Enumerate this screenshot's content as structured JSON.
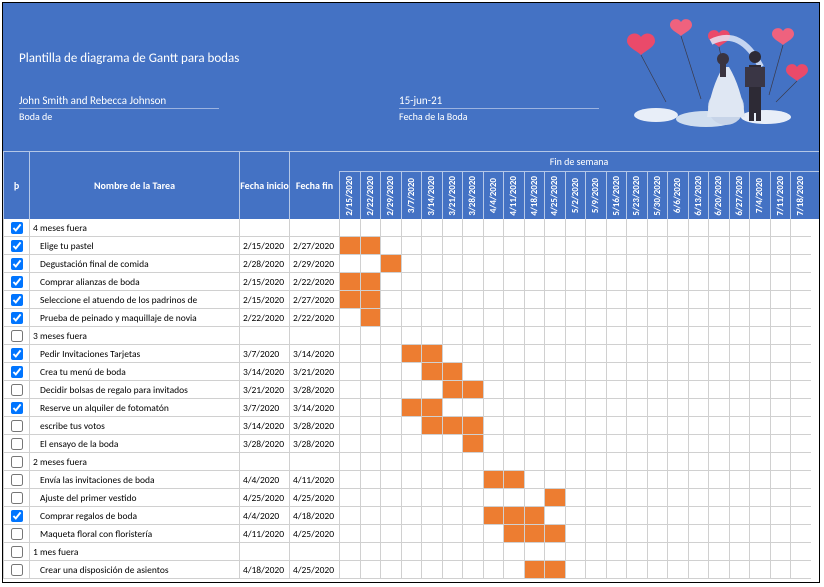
{
  "header": {
    "title": "Plantilla de diagrama de Gantt para bodas",
    "names": "John Smith and Rebecca Johnson",
    "boda_de": "Boda de",
    "wedding_date": "15-jun-21",
    "wedding_date_label": "Fecha de la Boda"
  },
  "columns": {
    "check": "þ",
    "task": "Nombre de la Tarea",
    "start": "Fecha inicio",
    "end": "Fecha fin",
    "weekend": "Fin de semana"
  },
  "dates": [
    "2/15/2020",
    "2/22/2020",
    "2/29/2020",
    "3/7/2020",
    "3/14/2020",
    "3/21/2020",
    "3/28/2020",
    "4/4/2020",
    "4/11/2020",
    "4/18/2020",
    "4/25/2020",
    "5/2/2020",
    "5/9/2020",
    "5/16/2020",
    "5/23/2020",
    "5/30/2020",
    "6/6/2020",
    "6/13/2020",
    "6/20/2020",
    "6/27/2020",
    "7/4/2020",
    "7/11/2020",
    "7/18/2020"
  ],
  "rows": [
    {
      "checked": true,
      "task": "4 meses fuera",
      "start": "",
      "end": "",
      "bars": [],
      "group": true,
      "indent": false
    },
    {
      "checked": true,
      "task": "Elige tu pastel",
      "start": "2/15/2020",
      "end": "2/27/2020",
      "bars": [
        0,
        1
      ],
      "group": false,
      "indent": true
    },
    {
      "checked": true,
      "task": "Degustación final de comida",
      "start": "2/28/2020",
      "end": "2/29/2020",
      "bars": [
        2
      ],
      "group": false,
      "indent": true
    },
    {
      "checked": true,
      "task": "Comprar alianzas de boda",
      "start": "2/15/2020",
      "end": "2/22/2020",
      "bars": [
        0,
        1
      ],
      "group": false,
      "indent": true
    },
    {
      "checked": true,
      "task": "Seleccione el atuendo de los padrinos de",
      "start": "2/15/2020",
      "end": "2/27/2020",
      "bars": [
        0,
        1
      ],
      "group": false,
      "indent": true
    },
    {
      "checked": true,
      "task": "Prueba de peinado y maquillaje de novia",
      "start": "2/22/2020",
      "end": "2/22/2020",
      "bars": [
        1
      ],
      "group": false,
      "indent": true
    },
    {
      "checked": false,
      "task": "3 meses fuera",
      "start": "",
      "end": "",
      "bars": [],
      "group": true,
      "indent": false
    },
    {
      "checked": true,
      "task": "Pedir Invitaciones Tarjetas",
      "start": "3/7/2020",
      "end": "3/14/2020",
      "bars": [
        3,
        4
      ],
      "group": false,
      "indent": true
    },
    {
      "checked": true,
      "task": "Crea tu menú de boda",
      "start": "3/14/2020",
      "end": "3/21/2020",
      "bars": [
        4,
        5
      ],
      "group": false,
      "indent": true
    },
    {
      "checked": false,
      "task": "Decidir bolsas de regalo para invitados",
      "start": "3/21/2020",
      "end": "3/28/2020",
      "bars": [
        5,
        6
      ],
      "group": false,
      "indent": true
    },
    {
      "checked": true,
      "task": "Reserve un alquiler de fotomatón",
      "start": "3/7/2020",
      "end": "3/14/2020",
      "bars": [
        3,
        4
      ],
      "group": false,
      "indent": true
    },
    {
      "checked": false,
      "task": "escribe tus votos",
      "start": "3/14/2020",
      "end": "3/28/2020",
      "bars": [
        4,
        5,
        6
      ],
      "group": false,
      "indent": true
    },
    {
      "checked": false,
      "task": "El ensayo de la boda",
      "start": "3/28/2020",
      "end": "3/28/2020",
      "bars": [
        6
      ],
      "group": false,
      "indent": true
    },
    {
      "checked": false,
      "task": "2 meses fuera",
      "start": "",
      "end": "",
      "bars": [],
      "group": true,
      "indent": false
    },
    {
      "checked": false,
      "task": "Envía las invitaciones de boda",
      "start": "4/4/2020",
      "end": "4/11/2020",
      "bars": [
        7,
        8
      ],
      "group": false,
      "indent": true
    },
    {
      "checked": false,
      "task": "Ajuste del primer vestido",
      "start": "4/25/2020",
      "end": "4/25/2020",
      "bars": [
        10
      ],
      "group": false,
      "indent": true
    },
    {
      "checked": true,
      "task": "Comprar regalos de boda",
      "start": "4/4/2020",
      "end": "4/18/2020",
      "bars": [
        7,
        8,
        9
      ],
      "group": false,
      "indent": true
    },
    {
      "checked": false,
      "task": "Maqueta floral con floristería",
      "start": "4/11/2020",
      "end": "4/25/2020",
      "bars": [
        8,
        9,
        10
      ],
      "group": false,
      "indent": true
    },
    {
      "checked": false,
      "task": "1 mes fuera",
      "start": "",
      "end": "",
      "bars": [],
      "group": true,
      "indent": false
    },
    {
      "checked": false,
      "task": "Crear una disposición de asientos",
      "start": "4/18/2020",
      "end": "4/25/2020",
      "bars": [
        9,
        10
      ],
      "group": false,
      "indent": true
    }
  ],
  "chart_data": {
    "type": "gantt",
    "title": "Plantilla de diagrama de Gantt para bodas",
    "xlabel": "Fin de semana",
    "x": [
      "2/15/2020",
      "2/22/2020",
      "2/29/2020",
      "3/7/2020",
      "3/14/2020",
      "3/21/2020",
      "3/28/2020",
      "4/4/2020",
      "4/11/2020",
      "4/18/2020",
      "4/25/2020",
      "5/2/2020",
      "5/9/2020",
      "5/16/2020",
      "5/23/2020",
      "5/30/2020",
      "6/6/2020",
      "6/13/2020",
      "6/20/2020",
      "6/27/2020",
      "7/4/2020",
      "7/11/2020",
      "7/18/2020"
    ],
    "series": [
      {
        "name": "Elige tu pastel",
        "start": "2/15/2020",
        "end": "2/27/2020"
      },
      {
        "name": "Degustación final de comida",
        "start": "2/28/2020",
        "end": "2/29/2020"
      },
      {
        "name": "Comprar alianzas de boda",
        "start": "2/15/2020",
        "end": "2/22/2020"
      },
      {
        "name": "Seleccione el atuendo de los padrinos de",
        "start": "2/15/2020",
        "end": "2/27/2020"
      },
      {
        "name": "Prueba de peinado y maquillaje de novia",
        "start": "2/22/2020",
        "end": "2/22/2020"
      },
      {
        "name": "Pedir Invitaciones Tarjetas",
        "start": "3/7/2020",
        "end": "3/14/2020"
      },
      {
        "name": "Crea tu menú de boda",
        "start": "3/14/2020",
        "end": "3/21/2020"
      },
      {
        "name": "Decidir bolsas de regalo para invitados",
        "start": "3/21/2020",
        "end": "3/28/2020"
      },
      {
        "name": "Reserve un alquiler de fotomatón",
        "start": "3/7/2020",
        "end": "3/14/2020"
      },
      {
        "name": "escribe tus votos",
        "start": "3/14/2020",
        "end": "3/28/2020"
      },
      {
        "name": "El ensayo de la boda",
        "start": "3/28/2020",
        "end": "3/28/2020"
      },
      {
        "name": "Envía las invitaciones de boda",
        "start": "4/4/2020",
        "end": "4/11/2020"
      },
      {
        "name": "Ajuste del primer vestido",
        "start": "4/25/2020",
        "end": "4/25/2020"
      },
      {
        "name": "Comprar regalos de boda",
        "start": "4/4/2020",
        "end": "4/18/2020"
      },
      {
        "name": "Maqueta floral con floristería",
        "start": "4/11/2020",
        "end": "4/25/2020"
      },
      {
        "name": "Crear una disposición de asientos",
        "start": "4/18/2020",
        "end": "4/25/2020"
      }
    ]
  }
}
